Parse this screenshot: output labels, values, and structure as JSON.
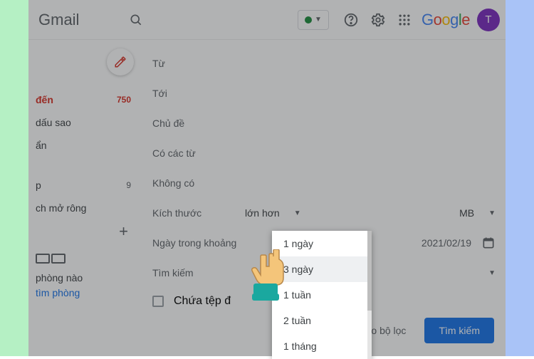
{
  "header": {
    "brand": "Gmail",
    "google": {
      "l1": "G",
      "l2": "o",
      "l3": "o",
      "l4": "g",
      "l5": "l",
      "l6": "e"
    },
    "avatar_initial": "T"
  },
  "sidebar": {
    "inbox_label": "đến",
    "inbox_count": "750",
    "starred": "dấu sao",
    "snoozed": "ẩn",
    "sent_label": "p",
    "sent_count": "9",
    "more": "ch mở rông",
    "footer_line1": "phòng nào",
    "footer_line2": "tìm phòng"
  },
  "filter": {
    "from": "Từ",
    "to": "Tới",
    "subject": "Chủ đề",
    "has_words": "Có các từ",
    "not_have": "Không có",
    "size_label": "Kích thước",
    "size_op": "lớn hơn",
    "size_unit": "MB",
    "date_label": "Ngày trong khoảng",
    "date_value": "2021/02/19",
    "search_label": "Tìm kiếm",
    "has_attachment": "Chứa tệp đ",
    "create_filter": "Tạo bộ lọc",
    "search_btn": "Tìm kiếm"
  },
  "dropdown": {
    "opt1": "1 ngày",
    "opt3": "3 ngày",
    "opt_w1": "1 tuần",
    "opt_w2": "2 tuần",
    "opt_m1": "1 tháng"
  }
}
